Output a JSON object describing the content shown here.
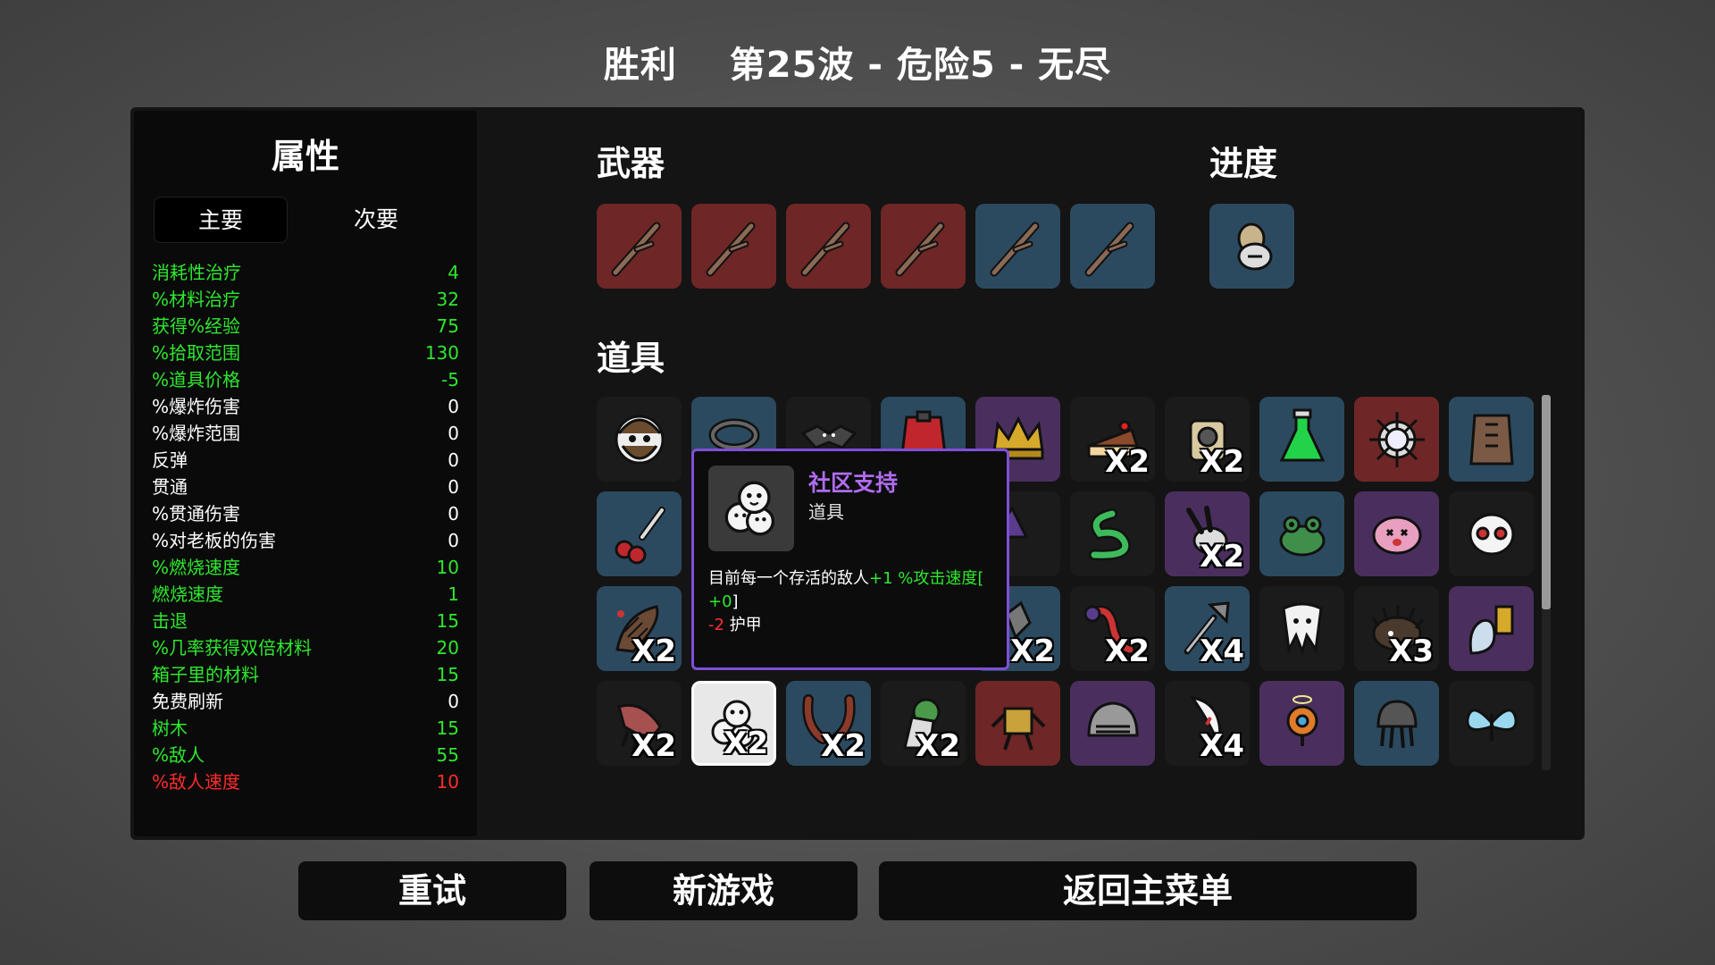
{
  "header": {
    "result": "胜利",
    "wave_info": "第25波 - 危险5 - 无尽"
  },
  "stats": {
    "title": "属性",
    "tab_main": "主要",
    "tab_secondary": "次要",
    "rows": [
      {
        "label": "消耗性治疗",
        "value": "4",
        "kind": "pos"
      },
      {
        "label": "%材料治疗",
        "value": "32",
        "kind": "pos"
      },
      {
        "label": "获得%经验",
        "value": "75",
        "kind": "pos"
      },
      {
        "label": "%拾取范围",
        "value": "130",
        "kind": "pos"
      },
      {
        "label": "%道具价格",
        "value": "-5",
        "kind": "pos"
      },
      {
        "label": "%爆炸伤害",
        "value": "0",
        "kind": "neu"
      },
      {
        "label": "%爆炸范围",
        "value": "0",
        "kind": "neu"
      },
      {
        "label": "反弹",
        "value": "0",
        "kind": "neu"
      },
      {
        "label": "贯通",
        "value": "0",
        "kind": "neu"
      },
      {
        "label": "%贯通伤害",
        "value": "0",
        "kind": "neu"
      },
      {
        "label": "%对老板的伤害",
        "value": "0",
        "kind": "neu"
      },
      {
        "label": "%燃烧速度",
        "value": "10",
        "kind": "pos"
      },
      {
        "label": "燃烧速度",
        "value": "1",
        "kind": "pos"
      },
      {
        "label": "击退",
        "value": "15",
        "kind": "pos"
      },
      {
        "label": "%几率获得双倍材料",
        "value": "20",
        "kind": "pos"
      },
      {
        "label": "箱子里的材料",
        "value": "15",
        "kind": "pos"
      },
      {
        "label": "免费刷新",
        "value": "0",
        "kind": "neu"
      },
      {
        "label": "树木",
        "value": "15",
        "kind": "pos"
      },
      {
        "label": "%敌人",
        "value": "55",
        "kind": "pos"
      },
      {
        "label": "%敌人速度",
        "value": "10",
        "kind": "neg"
      }
    ]
  },
  "sections": {
    "weapons": "武器",
    "progress": "进度",
    "items": "道具"
  },
  "weapons": [
    {
      "icon": "stick-icon",
      "tier": "red"
    },
    {
      "icon": "stick-icon",
      "tier": "red"
    },
    {
      "icon": "stick-icon",
      "tier": "red"
    },
    {
      "icon": "stick-icon",
      "tier": "red"
    },
    {
      "icon": "stick-icon",
      "tier": "blue"
    },
    {
      "icon": "stick-icon",
      "tier": "blue"
    }
  ],
  "progress_items": [
    {
      "icon": "compass-icon",
      "tier": "blue"
    }
  ],
  "items_rows": [
    [
      {
        "icon": "bearded-face-icon",
        "tier": "dark",
        "count": ""
      },
      {
        "icon": "ring-icon",
        "tier": "blue",
        "count": ""
      },
      {
        "icon": "bat-icon",
        "tier": "dark",
        "count": ""
      },
      {
        "icon": "cape-icon",
        "tier": "blue",
        "count": ""
      },
      {
        "icon": "crown-icon",
        "tier": "purple",
        "count": ""
      },
      {
        "icon": "cake-icon",
        "tier": "dark",
        "count": "X2"
      },
      {
        "icon": "camera-icon",
        "tier": "dark",
        "count": "X2"
      },
      {
        "icon": "potion-icon",
        "tier": "blue",
        "count": ""
      },
      {
        "icon": "spiked-orb-icon",
        "tier": "red",
        "count": ""
      },
      {
        "icon": "vest-icon",
        "tier": "blue",
        "count": ""
      }
    ],
    [
      {
        "icon": "cherry-knife-icon",
        "tier": "blue",
        "count": ""
      },
      {
        "icon": "hidden-icon",
        "tier": "dark",
        "count": ""
      },
      {
        "icon": "hidden-icon",
        "tier": "dark",
        "count": ""
      },
      {
        "icon": "hidden-icon",
        "tier": "dark",
        "count": ""
      },
      {
        "icon": "wizard-hat-icon",
        "tier": "dark",
        "count": ""
      },
      {
        "icon": "snake-icon",
        "tier": "dark",
        "count": ""
      },
      {
        "icon": "rabbit-icon",
        "tier": "purple",
        "count": "X2"
      },
      {
        "icon": "frog-icon",
        "tier": "blue",
        "count": ""
      },
      {
        "icon": "pink-blob-icon",
        "tier": "purple",
        "count": ""
      },
      {
        "icon": "skull-mask-icon",
        "tier": "dark",
        "count": ""
      }
    ],
    [
      {
        "icon": "grub-icon",
        "tier": "blue",
        "count": "X2"
      },
      {
        "icon": "hidden-icon",
        "tier": "dark",
        "count": ""
      },
      {
        "icon": "hidden-icon",
        "tier": "dark",
        "count": ""
      },
      {
        "icon": "hidden-icon",
        "tier": "dark",
        "count": ""
      },
      {
        "icon": "bullet-icon",
        "tier": "blue",
        "count": "X2"
      },
      {
        "icon": "tongue-icon",
        "tier": "dark",
        "count": "X2"
      },
      {
        "icon": "shovel-icon",
        "tier": "blue",
        "count": "X4"
      },
      {
        "icon": "tooth-icon",
        "tier": "dark",
        "count": ""
      },
      {
        "icon": "hedgehog-icon",
        "tier": "dark",
        "count": "X3"
      },
      {
        "icon": "ghost-lantern-icon",
        "tier": "purple",
        "count": ""
      }
    ],
    [
      {
        "icon": "claw-icon",
        "tier": "dark",
        "count": "X2"
      },
      {
        "icon": "community-support-icon",
        "tier": "white",
        "count": "X2"
      },
      {
        "icon": "horns-icon",
        "tier": "blue",
        "count": "X2"
      },
      {
        "icon": "bush-icon",
        "tier": "dark",
        "count": "X2"
      },
      {
        "icon": "robot-icon",
        "tier": "red",
        "count": ""
      },
      {
        "icon": "helmet-icon",
        "tier": "purple",
        "count": ""
      },
      {
        "icon": "fang-icon",
        "tier": "dark",
        "count": "X4"
      },
      {
        "icon": "drone-icon",
        "tier": "purple",
        "count": ""
      },
      {
        "icon": "jellyfish-icon",
        "tier": "blue",
        "count": ""
      },
      {
        "icon": "butterfly-icon",
        "tier": "dark",
        "count": ""
      }
    ]
  ],
  "tooltip": {
    "icon": "community-support-icon",
    "name": "社区支持",
    "type": "道具",
    "desc_prefix": "目前每一个存活的敌人",
    "desc_bonus": "+1 %攻击速度[",
    "desc_bonus2": "+0",
    "desc_bracket_close": "]",
    "desc_penalty": "-2",
    "desc_penalty_label": "护甲"
  },
  "buttons": {
    "retry": "重试",
    "new_game": "新游戏",
    "main_menu": "返回主菜单"
  },
  "colors": {
    "positive": "#2ee82e",
    "negative": "#ff2b2b",
    "tier_red": "#6f2626",
    "tier_blue": "#2c4a5f",
    "tier_purple": "#4a2f5e",
    "tooltip_border": "#7e4fd8"
  }
}
